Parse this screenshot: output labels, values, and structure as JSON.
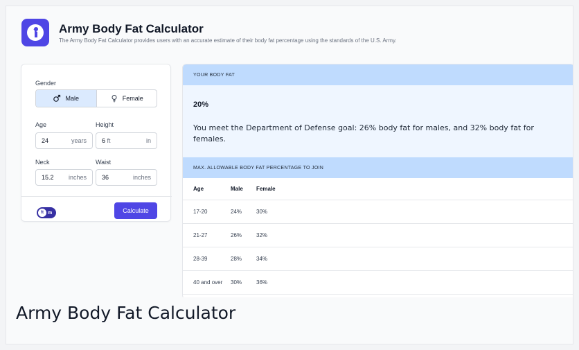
{
  "header": {
    "title": "Army Body Fat Calculator",
    "subtitle": "The Army Body Fat Calculator provides users with an accurate estimate of their body fat percentage using the standards of the U.S. Army.",
    "logo_icon": "soldier-salute-icon"
  },
  "form": {
    "gender_label": "Gender",
    "gender_options": [
      {
        "label": "Male",
        "icon": "male-symbol-icon",
        "selected": true
      },
      {
        "label": "Female",
        "icon": "female-symbol-icon",
        "selected": false
      }
    ],
    "age": {
      "label": "Age",
      "value": "24",
      "unit": "years"
    },
    "height": {
      "label": "Height",
      "value_ft": "6",
      "unit_ft": "ft",
      "value_in": "",
      "unit_in": "in"
    },
    "neck": {
      "label": "Neck",
      "value": "15.2",
      "unit": "inches"
    },
    "waist": {
      "label": "Waist",
      "value": "36",
      "unit": "inches"
    },
    "unit_toggle": {
      "left": "ft",
      "right": "m"
    },
    "calculate_label": "Calculate"
  },
  "result": {
    "header": "Your Body Fat",
    "percent": "20%",
    "message": "You meet the Department of Defense goal: 26% body fat for males, and 32% body fat for females."
  },
  "table": {
    "header": "Max. Allowable Body Fat Percentage to Join",
    "columns": [
      "Age",
      "Male",
      "Female"
    ],
    "rows": [
      [
        "17-20",
        "24%",
        "30%"
      ],
      [
        "21-27",
        "26%",
        "32%"
      ],
      [
        "28-39",
        "28%",
        "34%"
      ],
      [
        "40 and over",
        "30%",
        "36%"
      ]
    ]
  },
  "caption": "Army Body Fat Calculator",
  "colors": {
    "accent": "#4f46e5",
    "band": "#bfdbfe",
    "result_bg": "#eff6ff",
    "active_segment": "#dbeafe"
  }
}
